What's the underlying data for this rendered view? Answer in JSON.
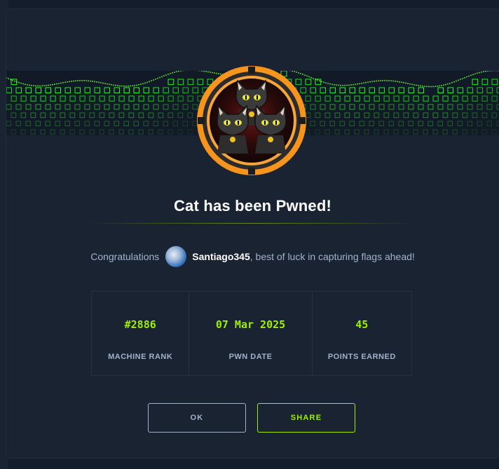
{
  "modal": {
    "title": "Cat has been Pwned!",
    "congrats_prefix": "Congratulations",
    "username": "Santiago345",
    "congrats_suffix": ", best of luck in capturing flags ahead!"
  },
  "stats": [
    {
      "value": "#2886",
      "label": "MACHINE RANK"
    },
    {
      "value": "07 Mar 2025",
      "label": "PWN DATE"
    },
    {
      "value": "45",
      "label": "POINTS EARNED"
    }
  ],
  "buttons": {
    "ok_label": "OK",
    "share_label": "SHARE"
  },
  "icons": {
    "badge": "cat-machine-badge-icon",
    "avatar": "user-avatar-icon"
  },
  "colors": {
    "accent": "#9fef00",
    "background": "#1a2332",
    "text_muted": "#a4b1cd",
    "badge_ring": "#f7941d"
  }
}
